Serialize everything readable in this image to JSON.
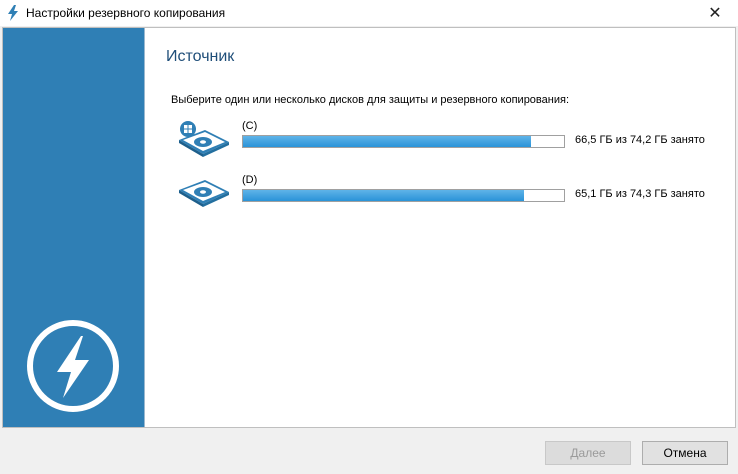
{
  "window": {
    "title": "Настройки резервного копирования",
    "close_glyph": "✕"
  },
  "main": {
    "heading": "Источник",
    "instruction": "Выберите один или несколько дисков для защиты и резервного копирования:"
  },
  "disks": [
    {
      "label": "(C)",
      "usage": "66,5 ГБ из 74,2 ГБ занято",
      "used_fraction": 0.896,
      "icon": "system-drive-icon"
    },
    {
      "label": "(D)",
      "usage": "65,1 ГБ из 74,3 ГБ занято",
      "used_fraction": 0.876,
      "icon": "hard-drive-icon"
    }
  ],
  "footer": {
    "next_label": "Далее",
    "cancel_label": "Отмена"
  },
  "colors": {
    "sidebar": "#2f7fb5",
    "heading": "#1f4e79",
    "progress": "#2a93d8"
  }
}
